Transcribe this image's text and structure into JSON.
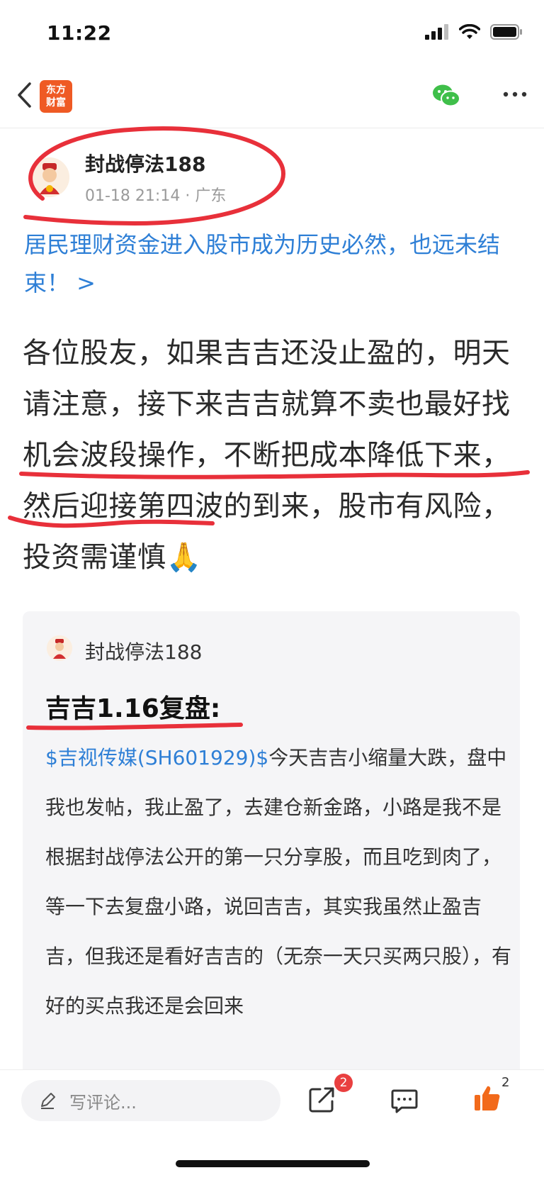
{
  "status_bar": {
    "time": "11:22"
  },
  "nav": {
    "logo_line1": "东方",
    "logo_line2": "财富"
  },
  "post": {
    "author": "封战停法188",
    "date": "01-18 21:14",
    "location": "广东",
    "topic": "居民理财资金进入股市成为历史必然，也远未结束！ >",
    "body": "各位股友，如果吉吉还没止盈的，明天请注意，接下来吉吉就算不卖也最好找机会波段操作，不断把成本降低下来，然后迎接第四波的到来，股市有风险，投资需谨慎",
    "body_emoji": "🙏"
  },
  "quote_card": {
    "author": "封战停法188",
    "title": "吉吉1.16复盘:",
    "stock_tag": "$吉视传媒(SH601929)$",
    "text": "今天吉吉小缩量大跌，盘中我也发帖，我止盈了，去建仓新金路，小路是我不是根据封战停法公开的第一只分享股，而且吃到肉了，等一下去复盘小路，说回吉吉，其实我虽然止盈吉吉，但我还是看好吉吉的（无奈一天只买两只股），有好的买点我还是会回来"
  },
  "bottom_bar": {
    "comment_placeholder": "写评论...",
    "share_badge": "2",
    "like_count": "2"
  },
  "colors": {
    "accent_link": "#2e7fd6",
    "brand": "#ef5a24",
    "like": "#f26a1b",
    "annotation": "#e8303a"
  }
}
